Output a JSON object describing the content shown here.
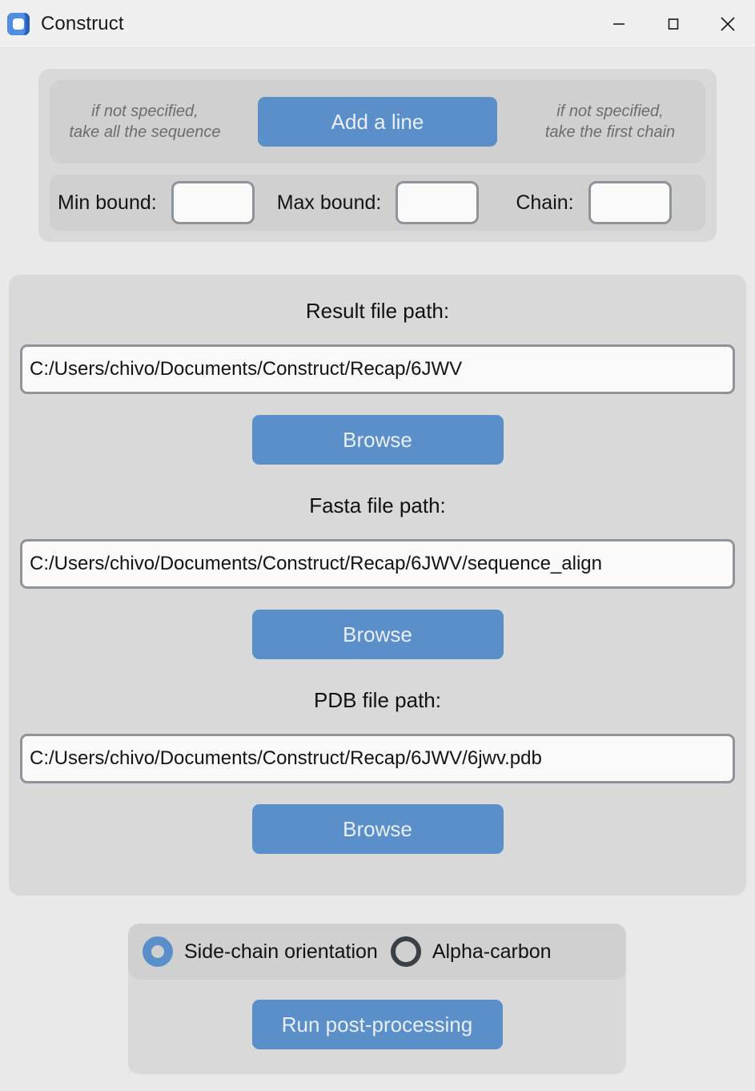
{
  "window": {
    "title": "Construct",
    "icon": "app-logo-icon",
    "controls": {
      "minimize": "minimize-icon",
      "maximize": "maximize-icon",
      "close": "close-icon"
    }
  },
  "colors": {
    "accent_blue": "#5b8fc9",
    "accent_blue_text": "#e9eff8",
    "body_background": "#e9e9e9",
    "titlebar_background": "#f0f0f0",
    "panel_background": "#d9d9d9",
    "subpanel_background": "#d0d0d0",
    "input_background": "#fafafa",
    "input_border": "#8e9499",
    "hint_text": "#6d6d6d",
    "radio_off_ring": "#3b4046"
  },
  "top_section": {
    "hint_left": "if not specified,\ntake all the sequence",
    "add_line_label": "Add a line",
    "hint_right": "if not specified,\ntake the first chain",
    "bounds": [
      {
        "label": "Min bound:",
        "value": "",
        "placeholder": ""
      },
      {
        "label": "Max bound:",
        "value": "",
        "placeholder": ""
      },
      {
        "label": "Chain:",
        "value": "",
        "placeholder": ""
      }
    ]
  },
  "files_section": {
    "browse_label": "Browse",
    "items": [
      {
        "label": "Result file path:",
        "value": "C:/Users/chivo/Documents/Construct/Recap/6JWV",
        "placeholder": ""
      },
      {
        "label": "Fasta file path:",
        "value": "C:/Users/chivo/Documents/Construct/Recap/6JWV/sequence_align",
        "placeholder": ""
      },
      {
        "label": "PDB file path:",
        "value": "C:/Users/chivo/Documents/Construct/Recap/6JWV/6jwv.pdb",
        "placeholder": ""
      }
    ]
  },
  "bottom_section": {
    "options": [
      {
        "label": "Side-chain orientation",
        "selected": true
      },
      {
        "label": "Alpha-carbon",
        "selected": false
      }
    ],
    "run_label": "Run post-processing"
  }
}
